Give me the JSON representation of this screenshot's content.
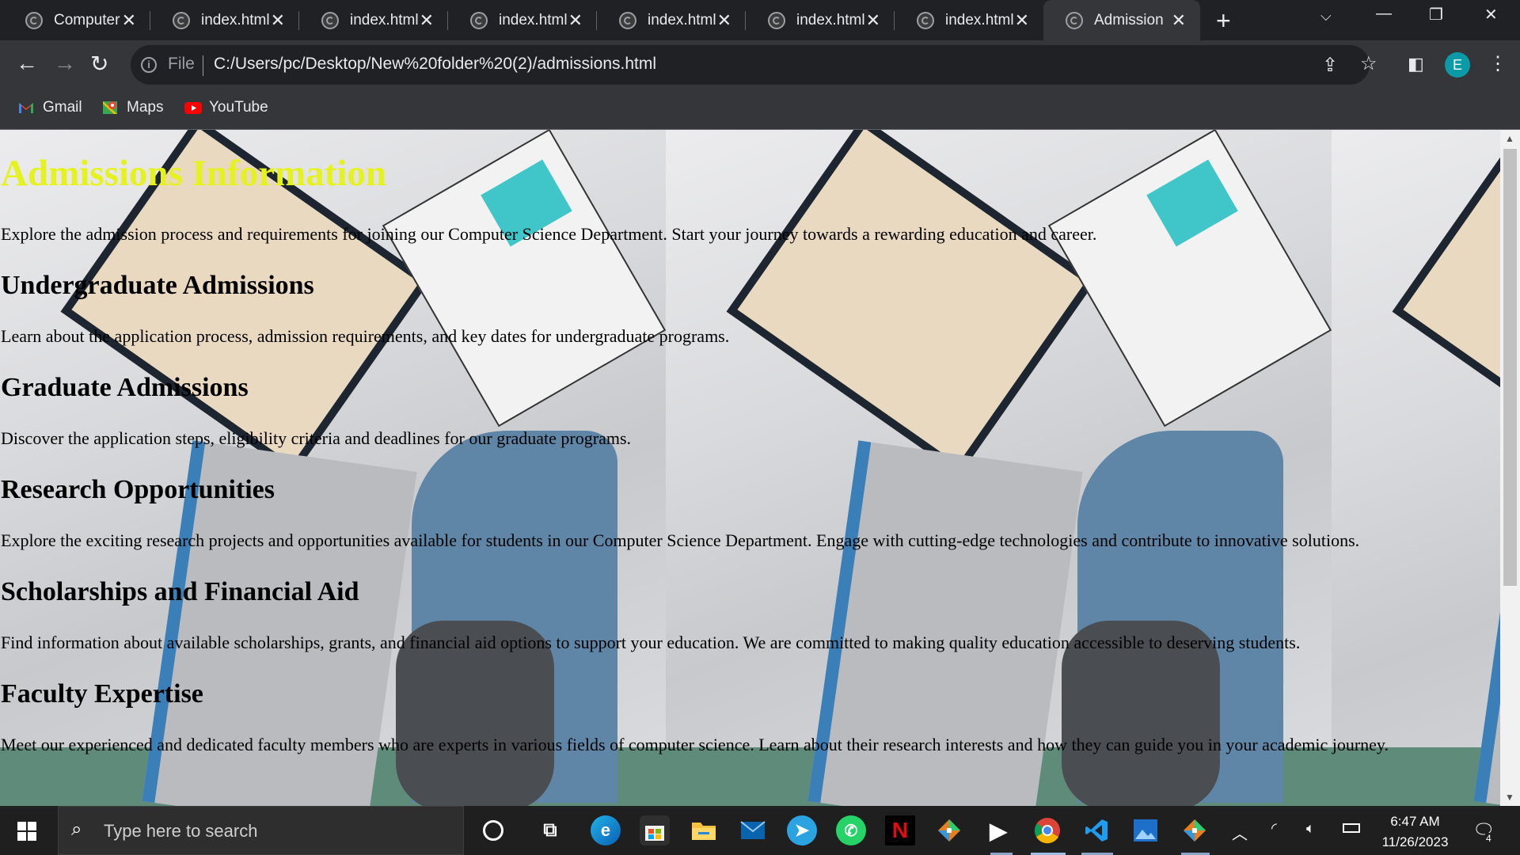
{
  "browser": {
    "tabs": [
      {
        "label": "Computer",
        "active": false
      },
      {
        "label": "index.html",
        "active": false
      },
      {
        "label": "index.html",
        "active": false
      },
      {
        "label": "index.html",
        "active": false
      },
      {
        "label": "index.html",
        "active": false
      },
      {
        "label": "index.html",
        "active": false
      },
      {
        "label": "index.html",
        "active": false
      },
      {
        "label": "Admission",
        "active": true
      }
    ],
    "omnibox": {
      "scheme_label": "File",
      "url": "C:/Users/pc/Desktop/New%20folder%20(2)/admissions.html"
    },
    "profile_initial": "E",
    "bookmarks": [
      {
        "label": "Gmail",
        "icon": "gmail-icon"
      },
      {
        "label": "Maps",
        "icon": "maps-icon"
      },
      {
        "label": "YouTube",
        "icon": "youtube-icon"
      }
    ]
  },
  "page": {
    "title": "Admissions Information",
    "intro": "Explore the admission process and requirements for joining our Computer Science Department. Start your journey towards a rewarding education and career.",
    "sections": [
      {
        "heading": "Undergraduate Admissions",
        "text": "Learn about the application process, admission requirements, and key dates for undergraduate programs."
      },
      {
        "heading": "Graduate Admissions",
        "text": "Discover the application steps, eligibility criteria and deadlines for our graduate programs."
      },
      {
        "heading": "Research Opportunities",
        "text": "Explore the exciting research projects and opportunities available for students in our Computer Science Department. Engage with cutting-edge technologies and contribute to innovative solutions."
      },
      {
        "heading": "Scholarships and Financial Aid",
        "text": "Find information about available scholarships, grants, and financial aid options to support your education. We are committed to making quality education accessible to deserving students."
      },
      {
        "heading": "Faculty Expertise",
        "text": "Meet our experienced and dedicated faculty members who are experts in various fields of computer science. Learn about their research interests and how they can guide you in your academic journey."
      }
    ],
    "colors": {
      "title": "#e6f21c",
      "text": "#000000"
    }
  },
  "taskbar": {
    "search_placeholder": "Type here to search",
    "time": "6:47 AM",
    "date": "11/26/2023",
    "notification_count": "4"
  }
}
